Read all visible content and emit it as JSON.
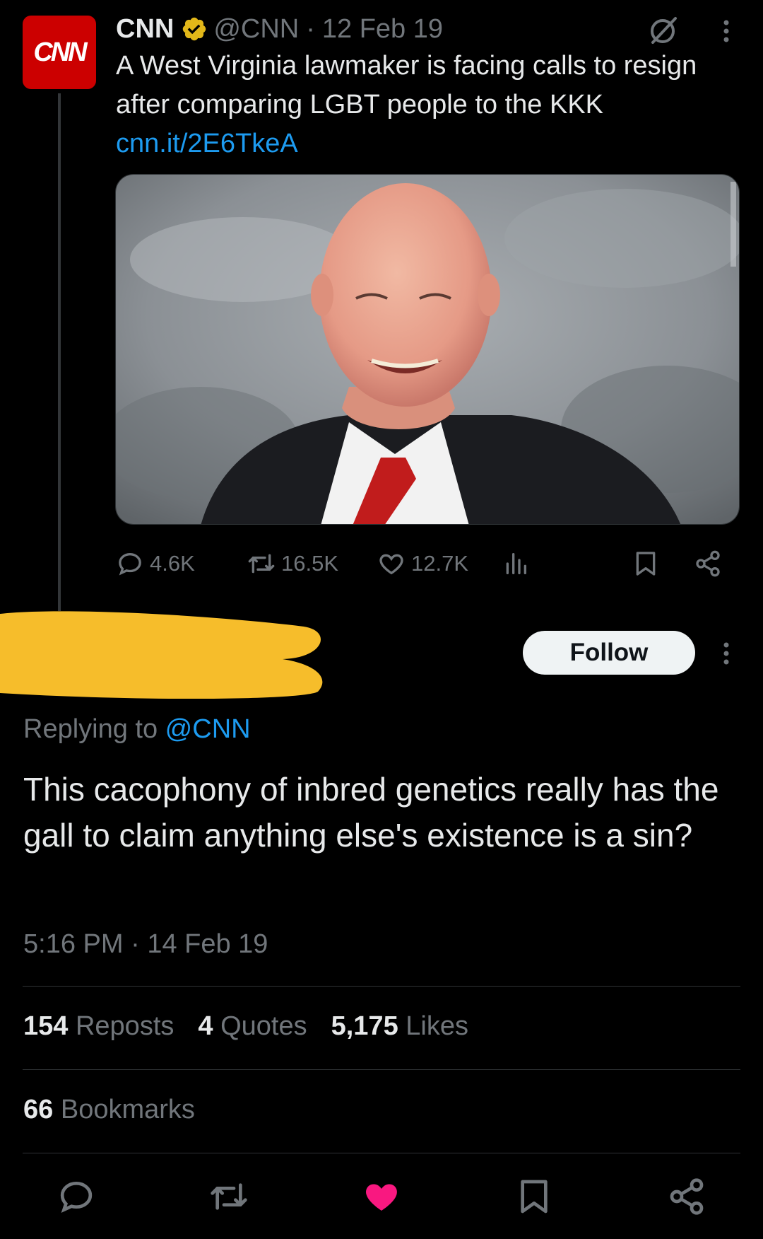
{
  "parent_tweet": {
    "author_name": "CNN",
    "handle": "@CNN",
    "separator": "·",
    "date": "12 Feb 19",
    "avatar_text": "CNN",
    "text": "A West Virginia lawmaker is facing calls to resign after comparing LGBT people to the KKK ",
    "link": "cnn.it/2E6TkeA",
    "stats": {
      "replies": "4.6K",
      "reposts": "16.5K",
      "likes": "12.7K"
    }
  },
  "reply_tweet": {
    "follow_label": "Follow",
    "replying_prefix": "Replying to ",
    "replying_handle": "@CNN",
    "text": "This cacophony of inbred genetics really has the gall to claim anything else's existence is a sin?",
    "time": "5:16 PM",
    "separator": "·",
    "date": "14 Feb 19",
    "reposts_count": "154",
    "reposts_label": "Reposts",
    "quotes_count": "4",
    "quotes_label": "Quotes",
    "likes_count": "5,175",
    "likes_label": "Likes",
    "bookmarks_count": "66",
    "bookmarks_label": "Bookmarks"
  },
  "colors": {
    "background": "#000000",
    "link": "#1d9bf0",
    "muted": "#71767b",
    "like_active": "#f91880",
    "verified_gold": "#e2b719",
    "cnn_red": "#cc0000",
    "redaction": "#f6bd2b"
  },
  "icons": [
    "verified-badge-icon",
    "grok-icon",
    "more-icon",
    "reply-icon",
    "repost-icon",
    "like-icon",
    "views-icon",
    "bookmark-icon",
    "share-icon"
  ]
}
